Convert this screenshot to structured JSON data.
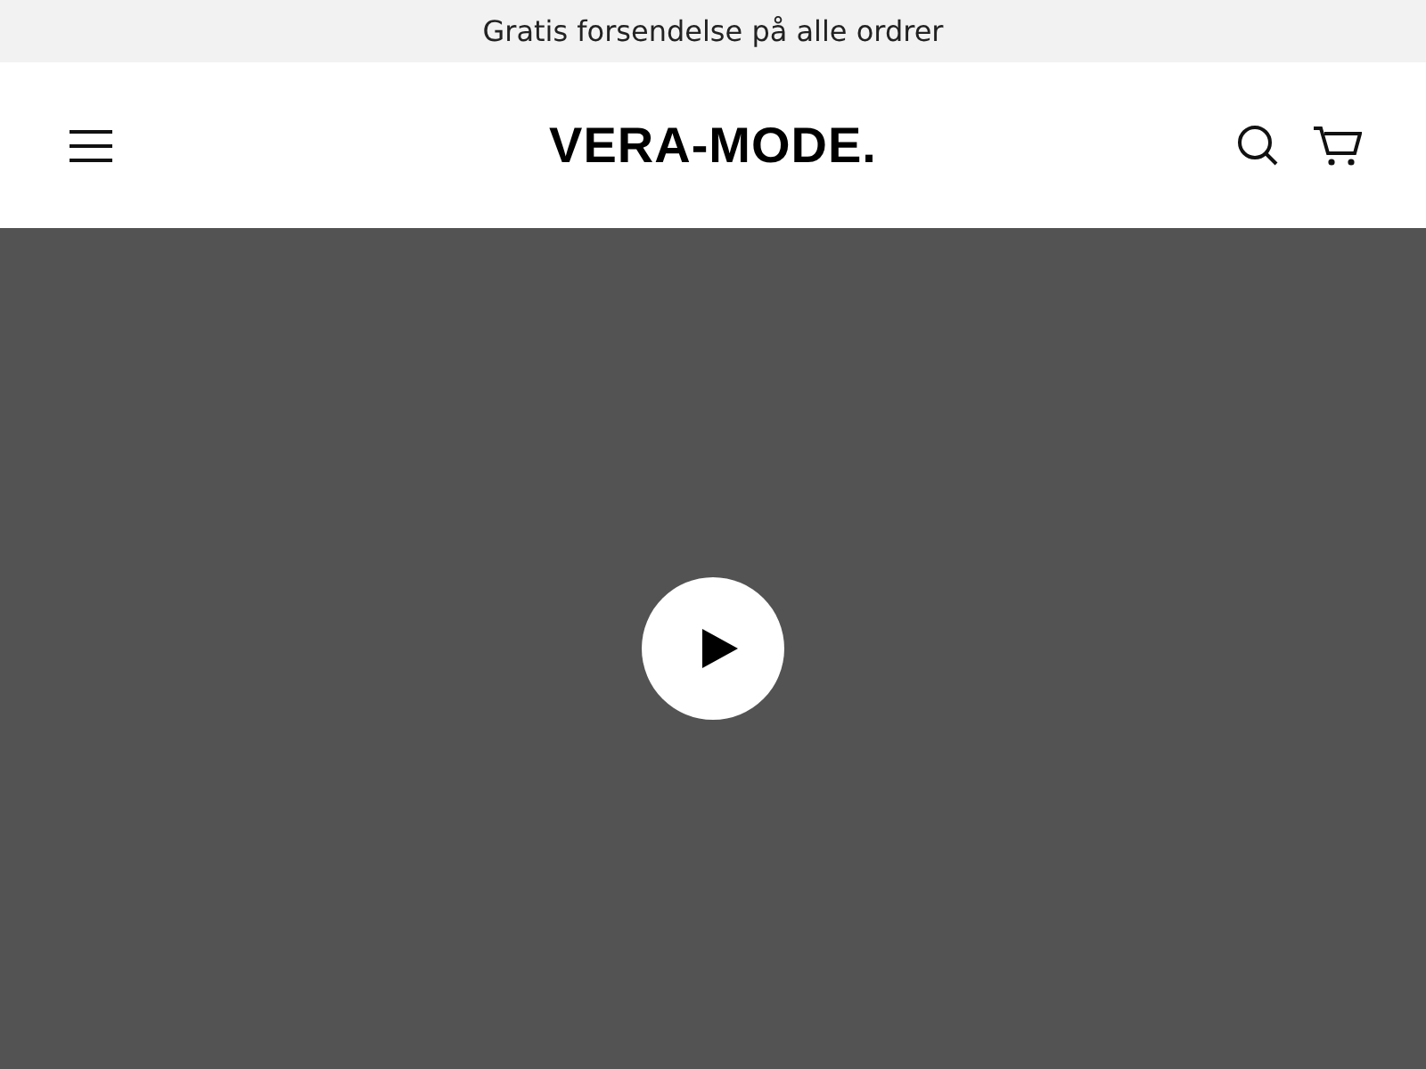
{
  "announcement": "Gratis forsendelse på alle ordrer",
  "header": {
    "logo": "VERA-MODE."
  },
  "hero": {
    "kind": "video"
  }
}
